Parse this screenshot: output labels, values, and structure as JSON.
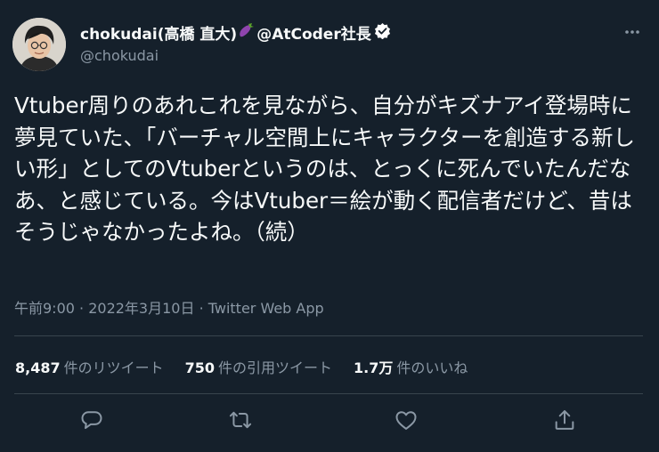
{
  "user": {
    "display_name": "chokudai(高橋 直大)",
    "name_suffix": "@AtCoder社長",
    "handle": "@chokudai"
  },
  "tweet": {
    "text": "Vtuber周りのあれこれを見ながら、自分がキズナアイ登場時に夢見ていた、「バーチャル空間上にキャラクターを創造する新しい形」としてのVtuberというのは、とっくに死んでいたんだなあ、と感じている。今はVtuber＝絵が動く配信者だけど、昔はそうじゃなかったよね。（続）",
    "time": "午前9:00",
    "date": "2022年3月10日",
    "client": "Twitter Web App",
    "separator": "·"
  },
  "stats": {
    "retweets": {
      "count": "8,487",
      "label": "件のリツイート"
    },
    "quotes": {
      "count": "750",
      "label": "件の引用ツイート"
    },
    "likes": {
      "count": "1.7万",
      "label": "件のいいね"
    }
  },
  "icons": {
    "more": "more-dots-icon",
    "reply": "reply-bubble-icon",
    "retweet": "retweet-icon",
    "like": "heart-icon",
    "share": "share-upload-icon",
    "verified": "verified-badge-icon",
    "eggplant": "eggplant-emoji-icon"
  },
  "colors": {
    "background": "#15202b",
    "primary_text": "#f7f9f9",
    "secondary_text": "#8b98a5",
    "divider": "#38444d",
    "verified_badge": "#ffffff"
  }
}
